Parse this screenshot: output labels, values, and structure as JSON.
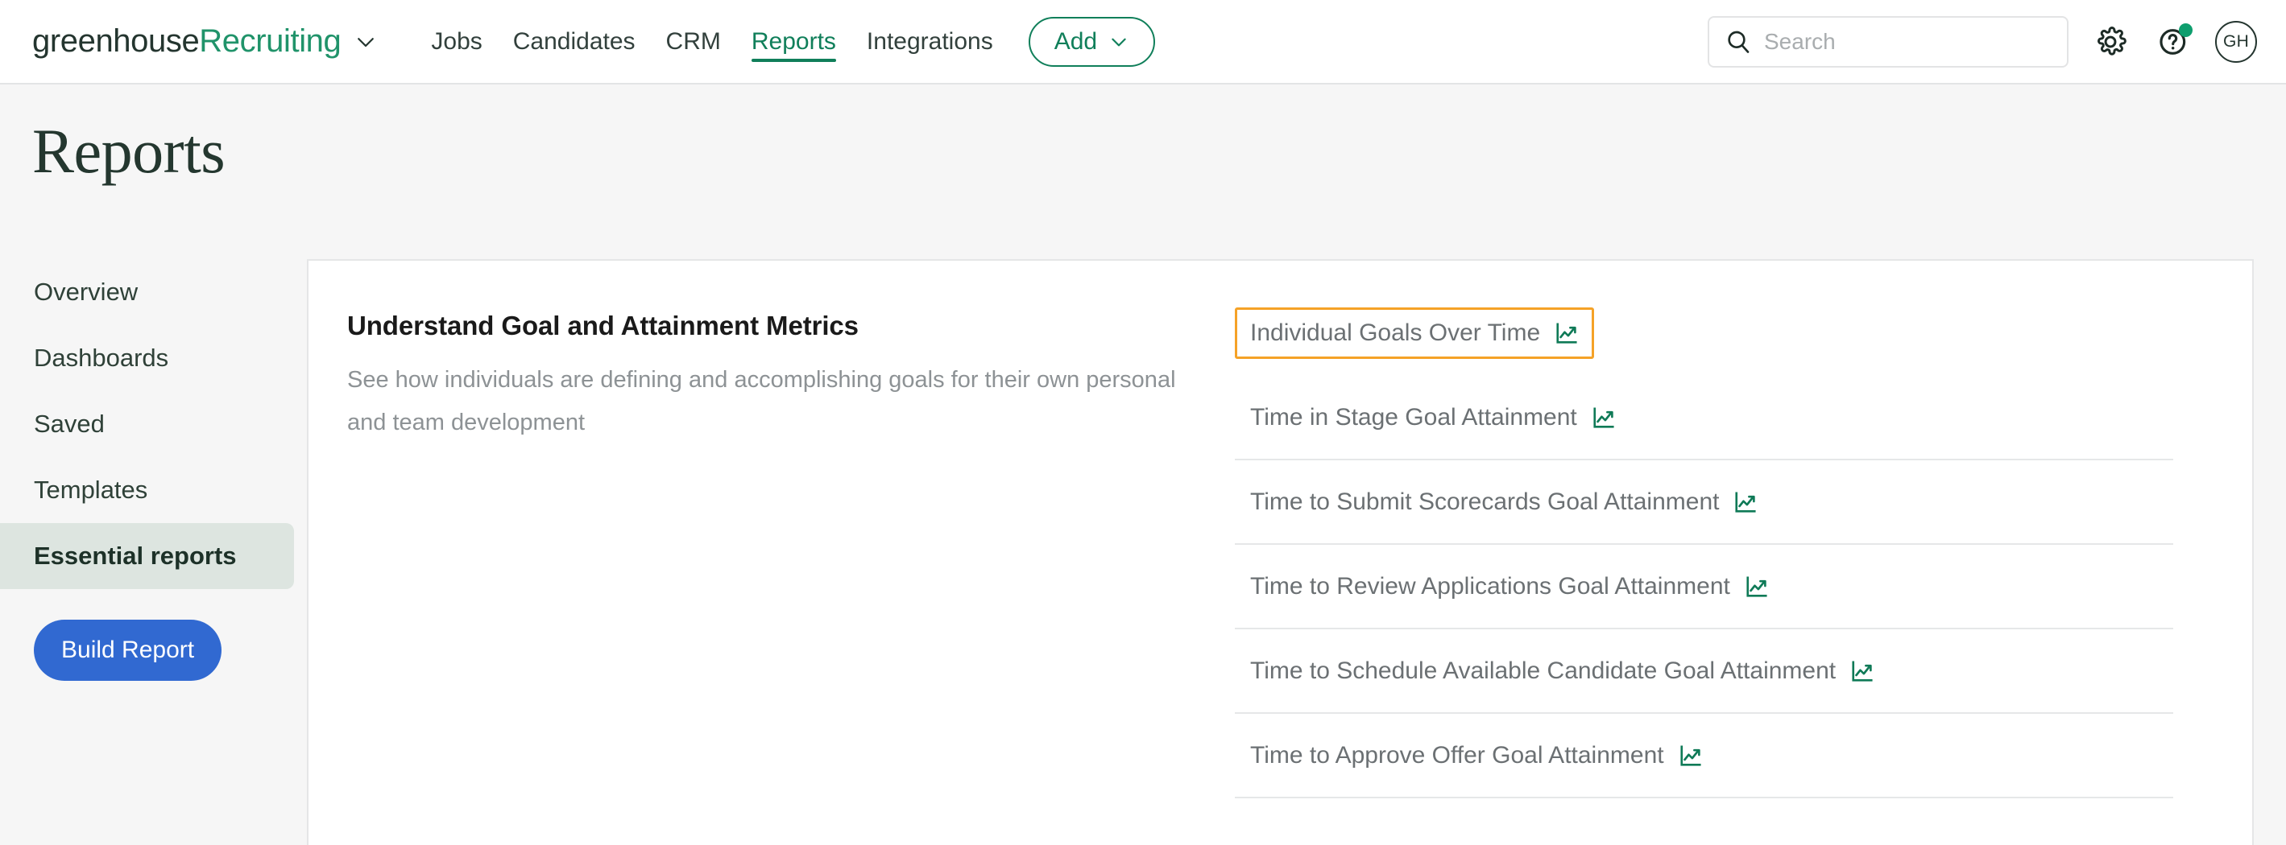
{
  "header": {
    "brand": {
      "name_dark": "greenhouse",
      "name_green": "Recruiting",
      "caret_icon": "chevron-down-icon"
    },
    "nav": [
      {
        "label": "Jobs",
        "active": false
      },
      {
        "label": "Candidates",
        "active": false
      },
      {
        "label": "CRM",
        "active": false
      },
      {
        "label": "Reports",
        "active": true
      },
      {
        "label": "Integrations",
        "active": false
      }
    ],
    "add_button": {
      "label": "Add",
      "caret_icon": "chevron-down-icon"
    },
    "search": {
      "placeholder": "Search",
      "value": "",
      "icon": "search-icon"
    },
    "settings_icon": "gear-icon",
    "help_icon": "question-mark-circle-icon",
    "avatar": {
      "initials": "GH"
    }
  },
  "page": {
    "title": "Reports"
  },
  "sidebar": {
    "items": [
      {
        "label": "Overview",
        "active": false
      },
      {
        "label": "Dashboards",
        "active": false
      },
      {
        "label": "Saved",
        "active": false
      },
      {
        "label": "Templates",
        "active": false
      },
      {
        "label": "Essential reports",
        "active": true
      }
    ],
    "build_report_label": "Build Report"
  },
  "main": {
    "section_heading": "Understand Goal and Attainment Metrics",
    "section_description": "See how individuals are defining and accomplishing goals for their own personal and team development",
    "reports": [
      {
        "label": "Individual Goals Over Time",
        "icon": "line-chart-icon",
        "focused": true
      },
      {
        "label": "Time in Stage Goal Attainment",
        "icon": "line-chart-icon",
        "focused": false
      },
      {
        "label": "Time to Submit Scorecards Goal Attainment",
        "icon": "line-chart-icon",
        "focused": false
      },
      {
        "label": "Time to Review Applications Goal Attainment",
        "icon": "line-chart-icon",
        "focused": false
      },
      {
        "label": "Time to Schedule Available Candidate Goal Attainment",
        "icon": "line-chart-icon",
        "focused": false
      },
      {
        "label": "Time to Approve Offer Goal Attainment",
        "icon": "line-chart-icon",
        "focused": false
      }
    ]
  },
  "colors": {
    "brand_green": "#20936a",
    "accent_green": "#107f5a",
    "dark_green": "#24352f",
    "focus_orange": "#f5a227",
    "primary_blue": "#3169d1",
    "page_bg": "#f6f6f6"
  }
}
